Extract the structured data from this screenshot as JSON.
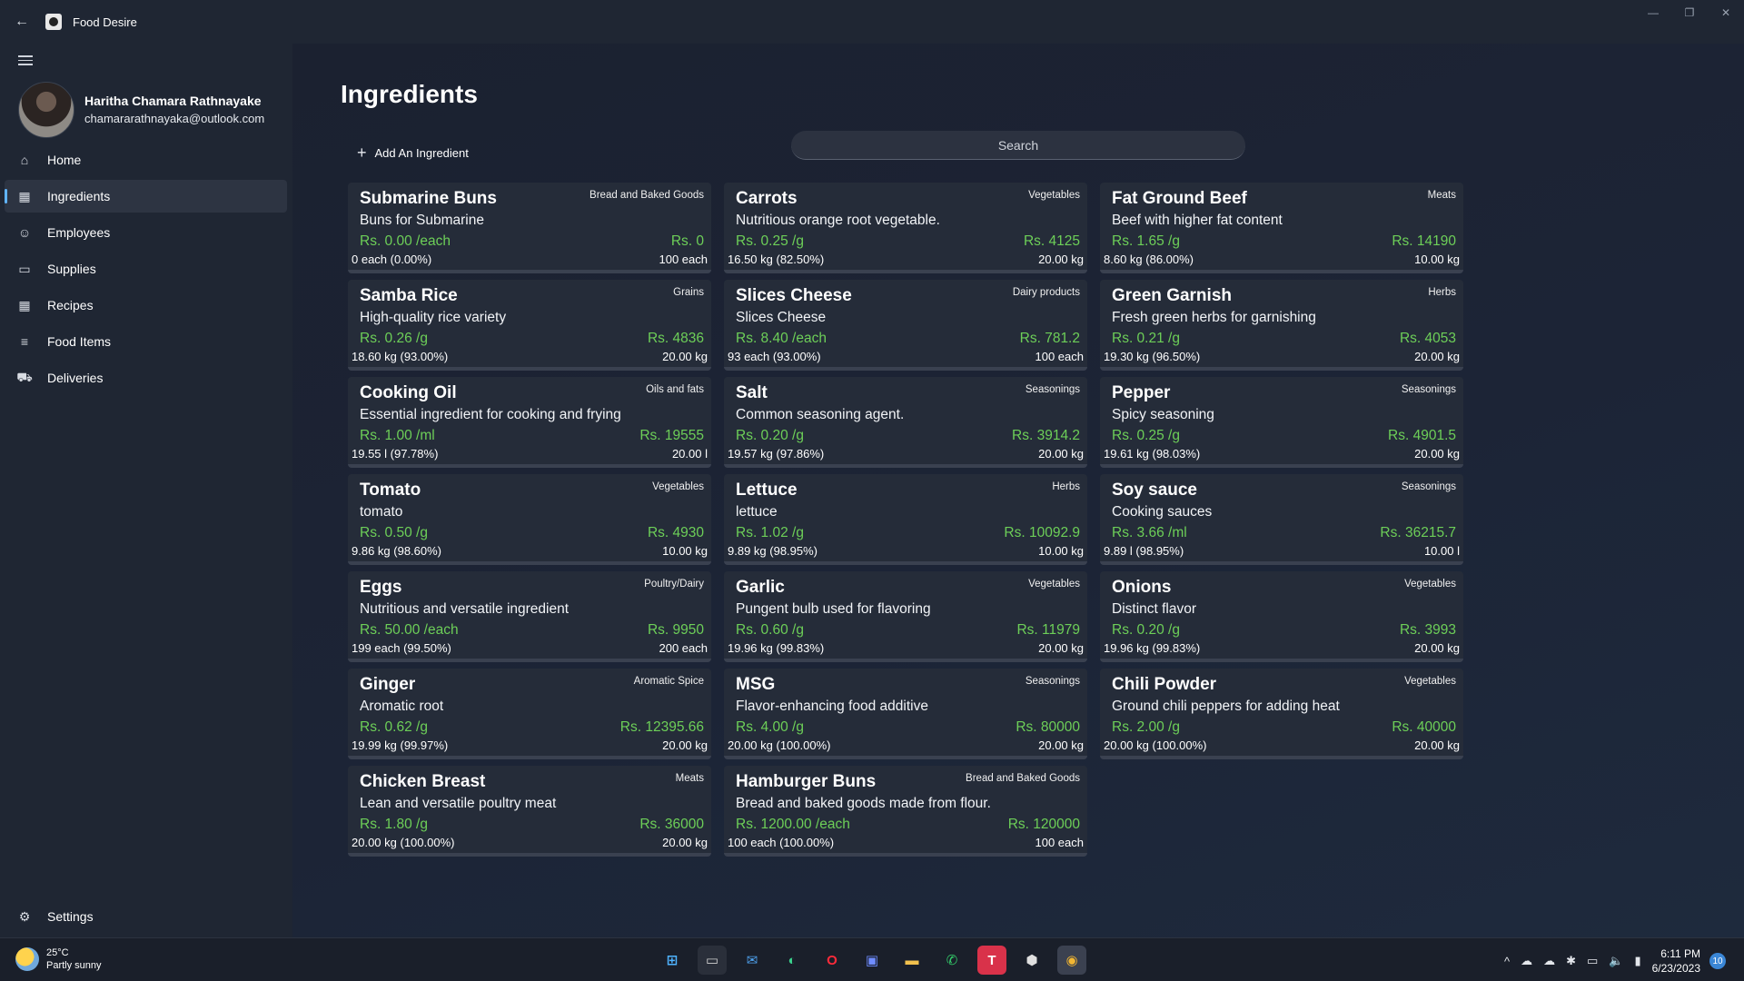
{
  "window": {
    "title": "Food Desire",
    "back_icon": "back-arrow-icon",
    "controls": [
      "—",
      "❐",
      "✕"
    ]
  },
  "user": {
    "name": "Haritha Chamara Rathnayake",
    "email": "chamararathnayaka@outlook.com"
  },
  "nav": {
    "items": [
      {
        "label": "Home",
        "icon": "⌂"
      },
      {
        "label": "Ingredients",
        "icon": "▦"
      },
      {
        "label": "Employees",
        "icon": "☺"
      },
      {
        "label": "Supplies",
        "icon": "▭"
      },
      {
        "label": "Recipes",
        "icon": "▦"
      },
      {
        "label": "Food Items",
        "icon": "≡"
      },
      {
        "label": "Deliveries",
        "icon": "⛟"
      }
    ],
    "settings": {
      "label": "Settings",
      "icon": "⚙"
    }
  },
  "page": {
    "title": "Ingredients",
    "add_label": "Add An Ingredient",
    "add_icon": "+",
    "search_placeholder": "Search"
  },
  "colors": {
    "accent": "#5ab3e8",
    "price": "#6dcf58",
    "progress_empty": "#8fd14f"
  },
  "cards": [
    {
      "name": "Submarine Buns",
      "category": "Bread and Baked Goods",
      "description": "Buns for Submarine",
      "price": "Rs.  0.00 /each",
      "total": "Rs.  0",
      "quantity": "0 each (0.00%)",
      "capacity": "100 each",
      "level": 0.0
    },
    {
      "name": "Carrots",
      "category": "Vegetables",
      "description": "Nutritious orange root vegetable.",
      "price": "Rs.  0.25 /g",
      "total": "Rs.  4125",
      "quantity": "16.50 kg (82.50%)",
      "capacity": "20.00 kg",
      "level": 0.825
    },
    {
      "name": "Fat Ground Beef",
      "category": "Meats",
      "description": "Beef with higher fat content",
      "price": "Rs.  1.65 /g",
      "total": "Rs.  14190",
      "quantity": "8.60 kg (86.00%)",
      "capacity": "10.00 kg",
      "level": 0.86
    },
    {
      "name": "Samba Rice",
      "category": "Grains",
      "description": "High-quality rice variety",
      "price": "Rs.  0.26 /g",
      "total": "Rs.  4836",
      "quantity": "18.60 kg (93.00%)",
      "capacity": "20.00 kg",
      "level": 0.93
    },
    {
      "name": "Slices Cheese",
      "category": "Dairy products",
      "description": "Slices Cheese",
      "price": "Rs.  8.40 /each",
      "total": "Rs.  781.2",
      "quantity": "93 each (93.00%)",
      "capacity": "100 each",
      "level": 0.93
    },
    {
      "name": "Green Garnish",
      "category": "Herbs",
      "description": "Fresh green herbs for garnishing",
      "price": "Rs.  0.21 /g",
      "total": "Rs.  4053",
      "quantity": "19.30 kg (96.50%)",
      "capacity": "20.00 kg",
      "level": 0.965
    },
    {
      "name": "Cooking Oil",
      "category": "Oils and fats",
      "description": " Essential ingredient for cooking and frying",
      "price": "Rs.  1.00 /ml",
      "total": "Rs.  19555",
      "quantity": "19.55 l (97.78%)",
      "capacity": "20.00 l",
      "level": 0.9778
    },
    {
      "name": "Salt",
      "category": "Seasonings",
      "description": "Common seasoning agent.",
      "price": "Rs.  0.20 /g",
      "total": "Rs.  3914.2",
      "quantity": "19.57 kg (97.86%)",
      "capacity": "20.00 kg",
      "level": 0.9786
    },
    {
      "name": "Pepper",
      "category": "Seasonings",
      "description": "Spicy seasoning",
      "price": "Rs.  0.25 /g",
      "total": "Rs.  4901.5",
      "quantity": "19.61 kg (98.03%)",
      "capacity": "20.00 kg",
      "level": 0.9803
    },
    {
      "name": "Tomato",
      "category": "Vegetables",
      "description": "tomato",
      "price": "Rs.  0.50 /g",
      "total": "Rs.  4930",
      "quantity": "9.86 kg (98.60%)",
      "capacity": "10.00 kg",
      "level": 0.986
    },
    {
      "name": "Lettuce",
      "category": "Herbs",
      "description": "lettuce",
      "price": "Rs.  1.02 /g",
      "total": "Rs.  10092.9",
      "quantity": "9.89 kg (98.95%)",
      "capacity": "10.00 kg",
      "level": 0.9895
    },
    {
      "name": "Soy sauce",
      "category": "Seasonings",
      "description": "Cooking sauces",
      "price": "Rs.  3.66 /ml",
      "total": "Rs.  36215.7",
      "quantity": "9.89 l (98.95%)",
      "capacity": "10.00 l",
      "level": 0.9895
    },
    {
      "name": "Eggs",
      "category": "Poultry/Dairy",
      "description": "Nutritious and versatile ingredient",
      "price": "Rs.  50.00 /each",
      "total": "Rs.  9950",
      "quantity": "199 each (99.50%)",
      "capacity": "200 each",
      "level": 0.995
    },
    {
      "name": "Garlic",
      "category": "Vegetables",
      "description": "Pungent bulb used for flavoring",
      "price": "Rs.  0.60 /g",
      "total": "Rs.  11979",
      "quantity": "19.96 kg (99.83%)",
      "capacity": "20.00 kg",
      "level": 0.9983
    },
    {
      "name": "Onions",
      "category": "Vegetables",
      "description": "Distinct flavor",
      "price": "Rs.  0.20 /g",
      "total": "Rs.  3993",
      "quantity": "19.96 kg (99.83%)",
      "capacity": "20.00 kg",
      "level": 0.9983
    },
    {
      "name": "Ginger",
      "category": "Aromatic Spice",
      "description": "Aromatic root",
      "price": "Rs.  0.62 /g",
      "total": "Rs.  12395.66",
      "quantity": "19.99 kg (99.97%)",
      "capacity": "20.00 kg",
      "level": 0.9997
    },
    {
      "name": "MSG",
      "category": "Seasonings",
      "description": " Flavor-enhancing food additive",
      "price": "Rs.  4.00 /g",
      "total": "Rs.  80000",
      "quantity": "20.00 kg (100.00%)",
      "capacity": "20.00 kg",
      "level": 1.0
    },
    {
      "name": "Chili Powder",
      "category": "Vegetables",
      "description": "Ground chili peppers for adding heat",
      "price": "Rs.  2.00 /g",
      "total": "Rs.  40000",
      "quantity": "20.00 kg (100.00%)",
      "capacity": "20.00 kg",
      "level": 1.0
    },
    {
      "name": "Chicken Breast",
      "category": "Meats",
      "description": "Lean and versatile poultry meat",
      "price": "Rs.  1.80 /g",
      "total": "Rs.  36000",
      "quantity": "20.00 kg (100.00%)",
      "capacity": "20.00 kg",
      "level": 1.0
    },
    {
      "name": "Hamburger Buns",
      "category": "Bread and Baked Goods",
      "description": "Bread and baked goods made from flour.",
      "price": "Rs.  1200.00 /each",
      "total": "Rs.  120000",
      "quantity": "100 each (100.00%)",
      "capacity": "100 each",
      "level": 1.0
    }
  ],
  "taskbar": {
    "weather_temp": "25°C",
    "weather_desc": "Partly sunny",
    "apps": [
      {
        "name": "start-icon",
        "glyph": "⊞",
        "color": "#4fb3ff",
        "bg": "transparent"
      },
      {
        "name": "terminal-icon",
        "glyph": "▭",
        "color": "#d0d0d0",
        "bg": "#2a2f3a"
      },
      {
        "name": "mail-icon",
        "glyph": "✉",
        "color": "#4fa3f0",
        "bg": "transparent"
      },
      {
        "name": "edge-icon",
        "glyph": "◐",
        "color": "#3ad18c",
        "bg": "transparent"
      },
      {
        "name": "opera-icon",
        "glyph": "O",
        "color": "#ff2b3a",
        "bg": "transparent"
      },
      {
        "name": "teams-icon",
        "glyph": "▣",
        "color": "#6f8cff",
        "bg": "transparent"
      },
      {
        "name": "file-explorer-icon",
        "glyph": "▬",
        "color": "#f2c14e",
        "bg": "transparent"
      },
      {
        "name": "whatsapp-icon",
        "glyph": "✆",
        "color": "#34d06b",
        "bg": "transparent"
      },
      {
        "name": "t-app-icon",
        "glyph": "T",
        "color": "#ffffff",
        "bg": "#d9324a"
      },
      {
        "name": "package-icon",
        "glyph": "⬢",
        "color": "#e0e0e0",
        "bg": "transparent"
      },
      {
        "name": "food-desire-icon",
        "glyph": "◉",
        "color": "#f2b632",
        "bg": "#3b4150"
      }
    ],
    "tray_icons": [
      "^",
      "☁",
      "☁",
      "✱",
      "▭",
      "🔈",
      "▮"
    ],
    "time": "6:11 PM",
    "date": "6/23/2023",
    "notification_count": "10"
  }
}
